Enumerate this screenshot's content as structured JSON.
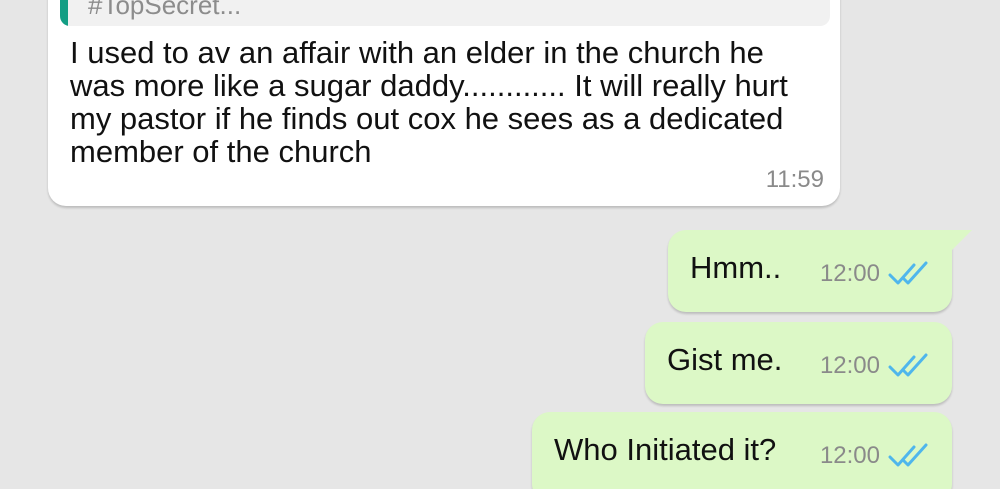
{
  "conversation": {
    "incoming": {
      "quote_text": "#TopSecret...",
      "text": "I used to av an affair with an elder in the church he was more like a sugar daddy............ It will really hurt my pastor if he finds out cox he sees as a dedicated member of the church",
      "time": "11:59"
    },
    "outgoing": [
      {
        "text": "Hmm..",
        "time": "12:00",
        "status_icon": "double-check-icon"
      },
      {
        "text": "Gist me.",
        "time": "12:00",
        "status_icon": "double-check-icon"
      },
      {
        "text": "Who Initiated it?",
        "time": "12:00",
        "status_icon": "double-check-icon"
      }
    ]
  },
  "colors": {
    "background": "#e6e6e6",
    "incoming_bubble": "#ffffff",
    "outgoing_bubble": "#dcf8c6",
    "quote_bar": "#139e84",
    "read_check": "#4fb6ec"
  }
}
